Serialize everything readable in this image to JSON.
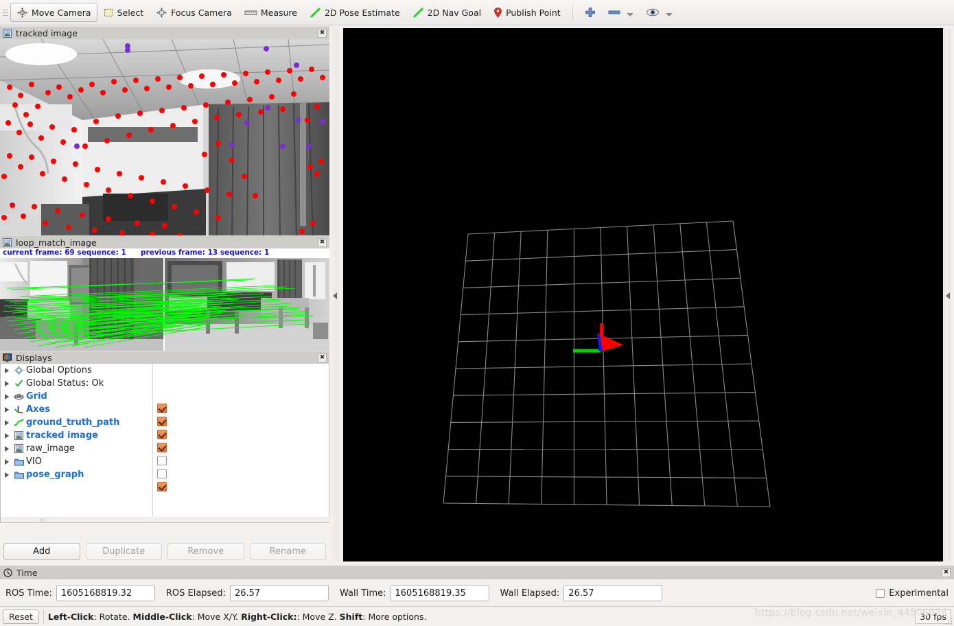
{
  "toolbar": {
    "tools": [
      {
        "label": "Move Camera",
        "icon": "move-camera-icon",
        "active": true
      },
      {
        "label": "Select",
        "icon": "select-icon",
        "active": false
      },
      {
        "label": "Focus Camera",
        "icon": "focus-camera-icon",
        "active": false
      },
      {
        "label": "Measure",
        "icon": "measure-icon",
        "active": false
      },
      {
        "label": "2D Pose Estimate",
        "icon": "pose-estimate-icon",
        "active": false
      },
      {
        "label": "2D Nav Goal",
        "icon": "nav-goal-icon",
        "active": false
      },
      {
        "label": "Publish Point",
        "icon": "publish-point-icon",
        "active": false
      }
    ],
    "add_tool_icon": "plus-icon",
    "remove_tool_icon": "minus-icon",
    "visibility_icon": "eye-icon"
  },
  "panels": {
    "tracked_image": {
      "title": "tracked image",
      "icon": "image-panel-icon",
      "close": "✖"
    },
    "loop_match_image": {
      "title": "loop_match_image",
      "icon": "image-panel-icon",
      "close": "✖",
      "overlay_left": "current frame: 69   sequence: 1",
      "overlay_right": "previous frame: 13   sequence: 1"
    },
    "displays": {
      "title": "Displays",
      "icon": "displays-panel-icon",
      "close": "✖"
    }
  },
  "displays": {
    "items": [
      {
        "label": "Global Options",
        "icon": "gear-icon",
        "enabled": true,
        "has_checkbox": false,
        "checked": false
      },
      {
        "label": "Global Status: Ok",
        "icon": "check-icon",
        "enabled": false,
        "has_checkbox": false,
        "checked": false
      },
      {
        "label": "Grid",
        "icon": "grid-icon",
        "enabled": true,
        "has_checkbox": true,
        "checked": true
      },
      {
        "label": "Axes",
        "icon": "axes-icon",
        "enabled": true,
        "has_checkbox": true,
        "checked": true
      },
      {
        "label": "ground_truth_path",
        "icon": "path-icon",
        "enabled": true,
        "has_checkbox": true,
        "checked": true
      },
      {
        "label": "tracked image",
        "icon": "image-icon",
        "enabled": true,
        "has_checkbox": true,
        "checked": true
      },
      {
        "label": "raw_image",
        "icon": "image-icon",
        "enabled": false,
        "has_checkbox": true,
        "checked": false
      },
      {
        "label": "VIO",
        "icon": "folder-icon",
        "enabled": false,
        "has_checkbox": true,
        "checked": false
      },
      {
        "label": "pose_graph",
        "icon": "folder-icon",
        "enabled": true,
        "has_checkbox": true,
        "checked": true
      }
    ],
    "buttons": [
      {
        "label": "Add",
        "disabled": false
      },
      {
        "label": "Duplicate",
        "disabled": true
      },
      {
        "label": "Remove",
        "disabled": true
      },
      {
        "label": "Rename",
        "disabled": true
      }
    ]
  },
  "time": {
    "title": "Time",
    "icon": "clock-icon",
    "close": "✖",
    "ros_time_label": "ROS Time:",
    "ros_time_value": "1605168819.32",
    "ros_elapsed_label": "ROS Elapsed:",
    "ros_elapsed_value": "26.57",
    "wall_time_label": "Wall Time:",
    "wall_time_value": "1605168819.35",
    "wall_elapsed_label": "Wall Elapsed:",
    "wall_elapsed_value": "26.57",
    "experimental_label": "Experimental",
    "experimental_checked": false
  },
  "statusbar": {
    "reset_label": "Reset",
    "hint_parts": [
      {
        "text": "Left-Click",
        "bold": true
      },
      {
        "text": ": Rotate. ",
        "bold": false
      },
      {
        "text": "Middle-Click",
        "bold": true
      },
      {
        "text": ": Move X/Y. ",
        "bold": false
      },
      {
        "text": "Right-Click:",
        "bold": true
      },
      {
        "text": ": Move Z. ",
        "bold": false
      },
      {
        "text": "Shift",
        "bold": true
      },
      {
        "text": ": More options.",
        "bold": false
      }
    ],
    "fps": "30 fps",
    "watermark": "https://blog.csdn.net/weixin_44506636"
  },
  "render_view": {
    "background": "#000000",
    "grid": {
      "line_color": "#8a8a8a",
      "cells": 10,
      "corners": {
        "tl": [
          682,
          341
        ],
        "tr": [
          1068,
          322
        ],
        "br": [
          1122,
          738
        ],
        "bl": [
          646,
          733
        ]
      }
    },
    "axes": {
      "origin": [
        875,
        511
      ],
      "x_color": "#ff0000",
      "y_color": "#00cc00",
      "z_color": "#0000ff"
    }
  },
  "colors": {
    "accent_blue": "#1f6fd0",
    "checkbox_orange": "#e27335",
    "panel_header": "#cfcdca",
    "toolbar_bg": "#f2f0ee",
    "feature_red": "#ff0000",
    "feature_purple": "#7a2fd0",
    "match_green": "#00ff00",
    "overlay_blue": "#1414e0"
  }
}
